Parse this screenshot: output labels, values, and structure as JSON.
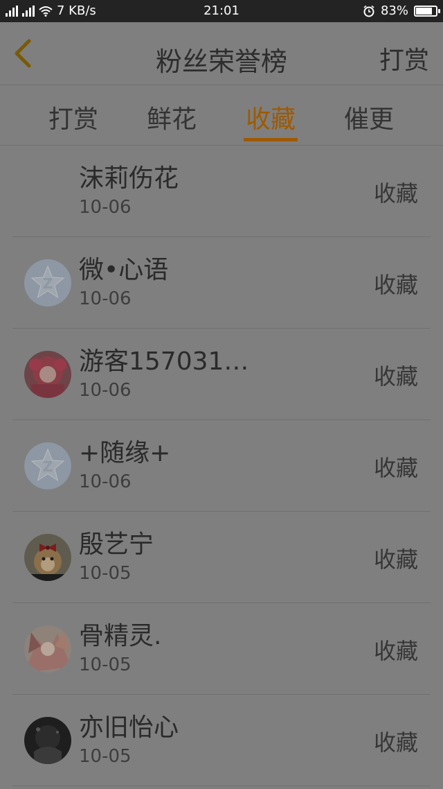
{
  "status_bar": {
    "network_speed": "7 KB/s",
    "time": "21:01",
    "battery": "83%",
    "battery_level": 0.83,
    "network_type": "3G"
  },
  "header": {
    "title": "粉丝荣誉榜",
    "right_action": "打赏"
  },
  "tabs": [
    {
      "label": "打赏",
      "active": false
    },
    {
      "label": "鲜花",
      "active": false
    },
    {
      "label": "收藏",
      "active": true
    },
    {
      "label": "催更",
      "active": false
    }
  ],
  "list": [
    {
      "name": "沫莉伤花",
      "date": "10-06",
      "action": "收藏",
      "avatar": "none"
    },
    {
      "name": "微•心语",
      "date": "10-06",
      "action": "收藏",
      "avatar": "default-star-icon"
    },
    {
      "name": "游客157031…",
      "date": "10-06",
      "action": "收藏",
      "avatar": "anime-girl-photo"
    },
    {
      "name": "+随缘+",
      "date": "10-06",
      "action": "收藏",
      "avatar": "default-star-icon"
    },
    {
      "name": "殷艺宁",
      "date": "10-05",
      "action": "收藏",
      "avatar": "dog-photo"
    },
    {
      "name": "骨精灵.",
      "date": "10-05",
      "action": "收藏",
      "avatar": "anime-illustration-photo"
    },
    {
      "name": "亦旧怡心",
      "date": "10-05",
      "action": "收藏",
      "avatar": "dark-photo"
    }
  ],
  "colors": {
    "accent": "#9e5a00",
    "overlay_bg": "#7f7f7f",
    "status_bar_bg": "#232323"
  }
}
